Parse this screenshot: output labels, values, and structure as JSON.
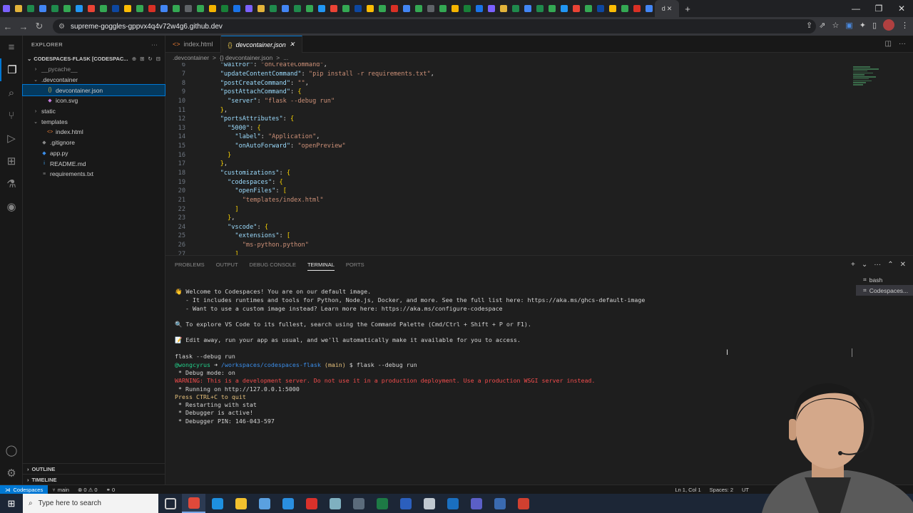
{
  "browser": {
    "url": "supreme-goggles-gppvx4q4v72w4g6.github.dev",
    "active_tab_label": "d",
    "tab_count": 54,
    "new_tab": "+",
    "window_min": "—",
    "window_max": "❐",
    "window_close": "✕"
  },
  "explorer": {
    "title": "EXPLORER",
    "more": "···",
    "workspace": "CODESPACES-FLASK [CODESPAC...",
    "items": [
      {
        "label": "__pycache__",
        "indent": 1,
        "twisty": "›",
        "icon": "",
        "dim": true
      },
      {
        "label": ".devcontainer",
        "indent": 1,
        "twisty": "⌄",
        "icon": ""
      },
      {
        "label": "devcontainer.json",
        "indent": 2,
        "twisty": "",
        "icon": "{}",
        "icon_color": "#e6c44a",
        "selected": true
      },
      {
        "label": "icon.svg",
        "indent": 2,
        "twisty": "",
        "icon": "◆",
        "icon_color": "#c77de0"
      },
      {
        "label": "static",
        "indent": 1,
        "twisty": "›",
        "icon": ""
      },
      {
        "label": "templates",
        "indent": 1,
        "twisty": "⌄",
        "icon": ""
      },
      {
        "label": "index.html",
        "indent": 2,
        "twisty": "",
        "icon": "<>",
        "icon_color": "#e37933"
      },
      {
        "label": ".gitignore",
        "indent": 1,
        "twisty": "",
        "icon": "◆",
        "icon_color": "#8a8a8a"
      },
      {
        "label": "app.py",
        "indent": 1,
        "twisty": "",
        "icon": "◆",
        "icon_color": "#3b8eea"
      },
      {
        "label": "README.md",
        "indent": 1,
        "twisty": "",
        "icon": "i",
        "icon_color": "#42a5f5"
      },
      {
        "label": "requirements.txt",
        "indent": 1,
        "twisty": "",
        "icon": "≡",
        "icon_color": "#8a8a8a"
      }
    ],
    "outline": "OUTLINE",
    "timeline": "TIMELINE"
  },
  "editor": {
    "tabs": [
      {
        "label": "index.html",
        "icon": "<>",
        "icon_color": "#e37933",
        "active": false
      },
      {
        "label": "devcontainer.json",
        "icon": "{}",
        "icon_color": "#e6c44a",
        "active": true,
        "close": "✕"
      }
    ],
    "breadcrumb": [
      ".devcontainer",
      ">",
      "{} devcontainer.json",
      ">",
      "..."
    ],
    "lines": [
      {
        "n": "6",
        "indent": 4,
        "parts": [
          [
            "k",
            "\"waitFor\""
          ],
          [
            "p",
            ": "
          ],
          [
            "s",
            "\"onCreateCommand\""
          ],
          [
            "p",
            ","
          ]
        ]
      },
      {
        "n": "7",
        "indent": 4,
        "parts": [
          [
            "k",
            "\"updateContentCommand\""
          ],
          [
            "p",
            ": "
          ],
          [
            "s",
            "\"pip install -r requirements.txt\""
          ],
          [
            "p",
            ","
          ]
        ]
      },
      {
        "n": "8",
        "indent": 4,
        "parts": [
          [
            "k",
            "\"postCreateCommand\""
          ],
          [
            "p",
            ": "
          ],
          [
            "s",
            "\"\""
          ],
          [
            "p",
            ","
          ]
        ]
      },
      {
        "n": "9",
        "indent": 4,
        "parts": [
          [
            "k",
            "\"postAttachCommand\""
          ],
          [
            "p",
            ": "
          ],
          [
            "b",
            "{"
          ]
        ]
      },
      {
        "n": "10",
        "indent": 6,
        "parts": [
          [
            "k",
            "\"server\""
          ],
          [
            "p",
            ": "
          ],
          [
            "s",
            "\"flask --debug run\""
          ]
        ]
      },
      {
        "n": "11",
        "indent": 4,
        "parts": [
          [
            "b",
            "}"
          ],
          [
            "p",
            ","
          ]
        ]
      },
      {
        "n": "12",
        "indent": 4,
        "parts": [
          [
            "k",
            "\"portsAttributes\""
          ],
          [
            "p",
            ": "
          ],
          [
            "b",
            "{"
          ]
        ]
      },
      {
        "n": "13",
        "indent": 6,
        "parts": [
          [
            "k",
            "\"5000\""
          ],
          [
            "p",
            ": "
          ],
          [
            "b",
            "{"
          ]
        ]
      },
      {
        "n": "14",
        "indent": 8,
        "parts": [
          [
            "k",
            "\"label\""
          ],
          [
            "p",
            ": "
          ],
          [
            "s",
            "\"Application\""
          ],
          [
            "p",
            ","
          ]
        ]
      },
      {
        "n": "15",
        "indent": 8,
        "parts": [
          [
            "k",
            "\"onAutoForward\""
          ],
          [
            "p",
            ": "
          ],
          [
            "s",
            "\"openPreview\""
          ]
        ]
      },
      {
        "n": "16",
        "indent": 6,
        "parts": [
          [
            "b",
            "}"
          ]
        ]
      },
      {
        "n": "17",
        "indent": 4,
        "parts": [
          [
            "b",
            "}"
          ],
          [
            "p",
            ","
          ]
        ]
      },
      {
        "n": "18",
        "indent": 4,
        "parts": [
          [
            "k",
            "\"customizations\""
          ],
          [
            "p",
            ": "
          ],
          [
            "b",
            "{"
          ]
        ]
      },
      {
        "n": "19",
        "indent": 6,
        "parts": [
          [
            "k",
            "\"codespaces\""
          ],
          [
            "p",
            ": "
          ],
          [
            "b",
            "{"
          ]
        ]
      },
      {
        "n": "20",
        "indent": 8,
        "parts": [
          [
            "k",
            "\"openFiles\""
          ],
          [
            "p",
            ": "
          ],
          [
            "b",
            "["
          ]
        ]
      },
      {
        "n": "21",
        "indent": 10,
        "parts": [
          [
            "s",
            "\"templates/index.html\""
          ]
        ]
      },
      {
        "n": "22",
        "indent": 8,
        "parts": [
          [
            "b",
            "]"
          ]
        ]
      },
      {
        "n": "23",
        "indent": 6,
        "parts": [
          [
            "b",
            "}"
          ],
          [
            "p",
            ","
          ]
        ]
      },
      {
        "n": "24",
        "indent": 6,
        "parts": [
          [
            "k",
            "\"vscode\""
          ],
          [
            "p",
            ": "
          ],
          [
            "b",
            "{"
          ]
        ]
      },
      {
        "n": "25",
        "indent": 8,
        "parts": [
          [
            "k",
            "\"extensions\""
          ],
          [
            "p",
            ": "
          ],
          [
            "b",
            "["
          ]
        ]
      },
      {
        "n": "26",
        "indent": 10,
        "parts": [
          [
            "s",
            "\"ms-python.python\""
          ]
        ]
      },
      {
        "n": "27",
        "indent": 8,
        "parts": [
          [
            "b",
            "]"
          ]
        ]
      }
    ]
  },
  "panel": {
    "tabs": [
      "PROBLEMS",
      "OUTPUT",
      "DEBUG CONSOLE",
      "TERMINAL",
      "PORTS"
    ],
    "active_tab": "TERMINAL",
    "terminal_lines": [
      [
        [
          "p",
          ""
        ]
      ],
      [
        [
          "p",
          "👋 Welcome to Codespaces! You are on our default image."
        ]
      ],
      [
        [
          "p",
          "   - It includes runtimes and tools for Python, Node.js, Docker, and more. See the full list here: https://aka.ms/ghcs-default-image"
        ]
      ],
      [
        [
          "p",
          "   - Want to use a custom image instead? Learn more here: https://aka.ms/configure-codespace"
        ]
      ],
      [
        [
          "p",
          ""
        ]
      ],
      [
        [
          "p",
          "🔍 To explore VS Code to its fullest, search using the Command Palette (Cmd/Ctrl + Shift + P or F1)."
        ]
      ],
      [
        [
          "p",
          ""
        ]
      ],
      [
        [
          "p",
          "📝 Edit away, run your app as usual, and we'll automatically make it available for you to access."
        ]
      ],
      [
        [
          "p",
          ""
        ]
      ],
      [
        [
          "p",
          "flask --debug run"
        ]
      ],
      [
        [
          "grn",
          "@wongcyrus"
        ],
        [
          "p",
          " ➜ "
        ],
        [
          "blu",
          "/workspaces/codespaces-flask"
        ],
        [
          "p",
          " "
        ],
        [
          "yel",
          "(main)"
        ],
        [
          "p",
          " $ flask --debug run"
        ]
      ],
      [
        [
          "p",
          " * Debug mode: on"
        ]
      ],
      [
        [
          "red",
          "WARNING: This is a development server. Do not use it in a production deployment. Use a production WSGI server instead."
        ]
      ],
      [
        [
          "p",
          " * Running on http://127.0.0.1:5000"
        ]
      ],
      [
        [
          "yel",
          "Press CTRL+C to quit"
        ]
      ],
      [
        [
          "p",
          " * Restarting with stat"
        ]
      ],
      [
        [
          "p",
          " * Debugger is active!"
        ]
      ],
      [
        [
          "p",
          " * Debugger PIN: 146-043-597"
        ]
      ]
    ],
    "terminals": [
      "bash",
      "Codespaces..."
    ],
    "active_terminal": "Codespaces..."
  },
  "status": {
    "remote": "Codespaces",
    "branch": "main",
    "problems": "⊗ 0 ⚠ 0",
    "ports": "⚭ 0",
    "position": "Ln 1, Col 1",
    "spaces": "Spaces: 2",
    "encoding": "UT"
  },
  "taskbar": {
    "search_placeholder": "Type here to search",
    "apps": [
      {
        "name": "task-view",
        "color": "#cccccc"
      },
      {
        "name": "chrome",
        "color": "#e0493a",
        "active": true
      },
      {
        "name": "edge",
        "color": "#1e90e0"
      },
      {
        "name": "file-explorer",
        "color": "#f2c12e"
      },
      {
        "name": "app-5",
        "color": "#5aa0e0"
      },
      {
        "name": "vscode",
        "color": "#2a8fe0"
      },
      {
        "name": "acrobat",
        "color": "#d9312b"
      },
      {
        "name": "app-8",
        "color": "#7fb0c0"
      },
      {
        "name": "calculator",
        "color": "#5b6b7b"
      },
      {
        "name": "excel",
        "color": "#1d7a45"
      },
      {
        "name": "word",
        "color": "#2b5fbd"
      },
      {
        "name": "app-12",
        "color": "#c0c8d0"
      },
      {
        "name": "outlook",
        "color": "#1a6fc0"
      },
      {
        "name": "teams",
        "color": "#5b5fc7"
      },
      {
        "name": "app-15",
        "color": "#3a6ab0"
      },
      {
        "name": "app-16",
        "color": "#d04030"
      }
    ]
  },
  "colors": {
    "accent": "#0078d4",
    "selection": "#04395e"
  }
}
